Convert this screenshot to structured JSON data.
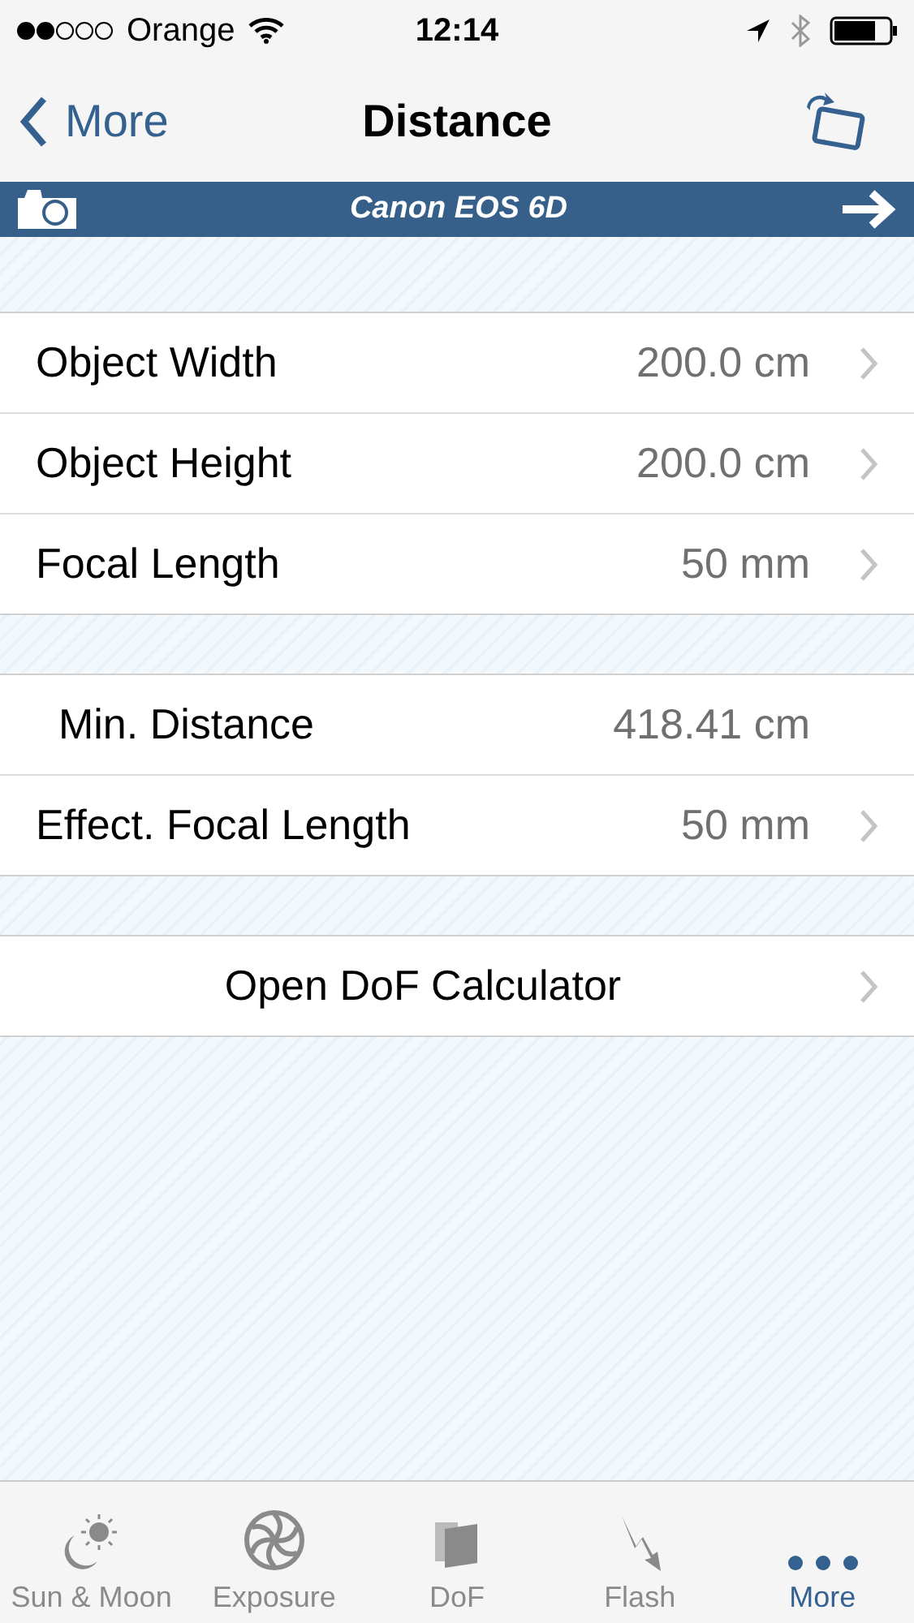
{
  "status_bar": {
    "carrier": "Orange",
    "time": "12:14"
  },
  "nav": {
    "back": "More",
    "title": "Distance"
  },
  "camera_bar": {
    "title": "Canon EOS 6D"
  },
  "sections": [
    {
      "rows": [
        {
          "kind": "link",
          "label": "Object Width",
          "value": "200.0 cm"
        },
        {
          "kind": "link",
          "label": "Object Height",
          "value": "200.0 cm"
        },
        {
          "kind": "link",
          "label": "Focal Length",
          "value": "50 mm"
        }
      ]
    },
    {
      "rows": [
        {
          "kind": "result",
          "label": "Min. Distance",
          "value": "418.41 cm"
        },
        {
          "kind": "link",
          "label": "Effect. Focal Length",
          "value": "50 mm"
        }
      ]
    },
    {
      "rows": [
        {
          "kind": "action",
          "label": "Open DoF Calculator"
        }
      ]
    }
  ],
  "tab_bar": [
    {
      "label": "Sun & Moon",
      "selected": false
    },
    {
      "label": "Exposure",
      "selected": false
    },
    {
      "label": "DoF",
      "selected": false
    },
    {
      "label": "Flash",
      "selected": false
    },
    {
      "label": "More",
      "selected": true
    }
  ]
}
